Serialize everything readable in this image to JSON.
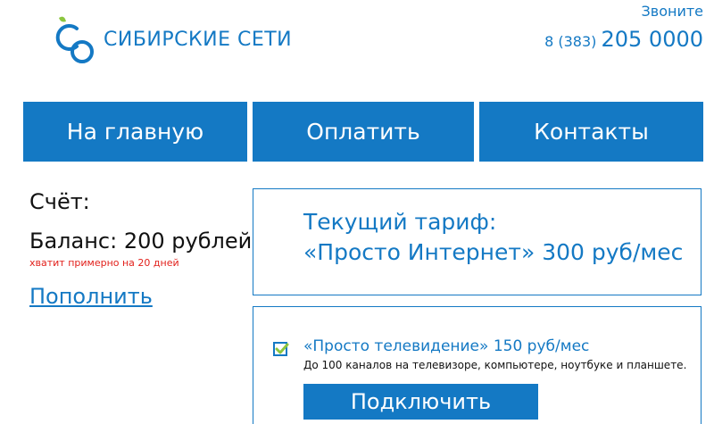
{
  "brand": {
    "name": "СИБИРСКИЕ СЕТИ"
  },
  "header": {
    "call_label": "Звоните",
    "phone_code": "8 (383)",
    "phone_number": "205 0000"
  },
  "nav": {
    "items": [
      {
        "label": "На главную"
      },
      {
        "label": "Оплатить"
      },
      {
        "label": "Контакты"
      }
    ]
  },
  "account": {
    "label": "Счёт:",
    "balance": "Баланс: 200 рублей",
    "hint": "хватит примерно на 20 дней",
    "topup_label": "Пополнить"
  },
  "tariff": {
    "title": "Текущий тариф:",
    "name": "«Просто Интернет» 300 руб/мес"
  },
  "offer": {
    "checked": true,
    "title": "«Просто телевидение» 150 руб/мес",
    "description": "До 100 каналов на телевизоре, компьютере, ноутбуке и планшете.",
    "button_label": "Подключить"
  },
  "colors": {
    "brand_blue": "#1479c4",
    "logo_green": "#8cc63f",
    "hint_red": "#e2211c"
  }
}
